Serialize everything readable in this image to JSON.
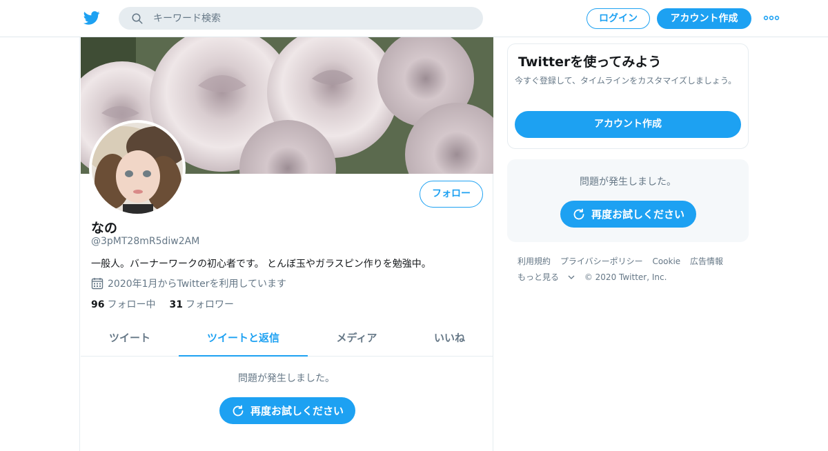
{
  "header": {
    "search_placeholder": "キーワード検索",
    "login_label": "ログイン",
    "signup_label": "アカウント作成"
  },
  "profile": {
    "name": "なの",
    "handle": "@3pMT28mR5diw2AM",
    "bio": "一般人。バーナーワークの初心者です。 とんぼ玉やガラスピン作りを勉強中。",
    "joined": "2020年1月からTwitterを利用しています",
    "following_count": "96",
    "following_label": "フォロー中",
    "followers_count": "31",
    "followers_label": "フォロワー",
    "follow_label": "フォロー"
  },
  "tabs": [
    {
      "label": "ツイート",
      "active": false
    },
    {
      "label": "ツイートと返信",
      "active": true
    },
    {
      "label": "メディア",
      "active": false
    },
    {
      "label": "いいね",
      "active": false
    }
  ],
  "timeline_error": {
    "message": "問題が発生しました。",
    "retry_label": "再度お試しください"
  },
  "signup_card": {
    "title": "Twitterを使ってみよう",
    "description": "今すぐ登録して、タイムラインをカスタマイズしましょう。",
    "button_label": "アカウント作成"
  },
  "side_error": {
    "message": "問題が発生しました。",
    "retry_label": "再度お試しください"
  },
  "footer": {
    "links": [
      "利用規約",
      "プライバシーポリシー",
      "Cookie",
      "広告情報"
    ],
    "more_label": "もっと見る",
    "copyright": "© 2020 Twitter, Inc."
  },
  "colors": {
    "accent": "#1da1f2",
    "muted_text": "#657786",
    "border": "#e6ecf0"
  }
}
